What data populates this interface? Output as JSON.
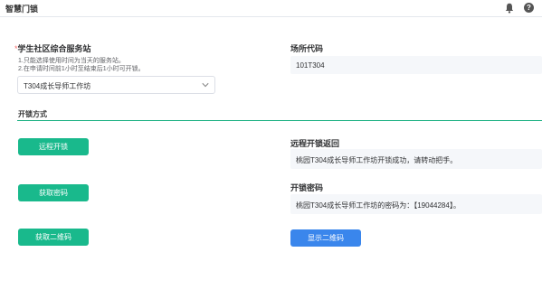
{
  "header": {
    "title": "智慧门锁",
    "bell_icon": "bell-icon",
    "help_icon": "help-icon",
    "help_glyph": "?"
  },
  "form": {
    "station": {
      "required_mark": "*",
      "label": "学生社区综合服务站",
      "hint1": "1.只能选择使用时间为当天的服务站。",
      "hint2": "2.在申请时间前1小时至结束后1小时可开锁。",
      "selected": "T304成长导师工作坊"
    },
    "venue_code": {
      "label": "场所代码",
      "value": "101T304"
    }
  },
  "unlock": {
    "section_title": "开锁方式",
    "remote_button": "远程开锁",
    "get_password_button": "获取密码",
    "get_qr_button": "获取二维码",
    "remote_result_label": "远程开锁返回",
    "remote_result_value": "桃园T304成长导师工作坊开锁成功，请转动把手。",
    "password_label": "开锁密码",
    "password_value": "桃园T304成长导师工作坊的密码为：【19044284】。",
    "show_qr_button": "显示二维码"
  },
  "colors": {
    "primary": "#19b98c",
    "blue": "#3a86ec",
    "section_line": "#13ad7e"
  }
}
